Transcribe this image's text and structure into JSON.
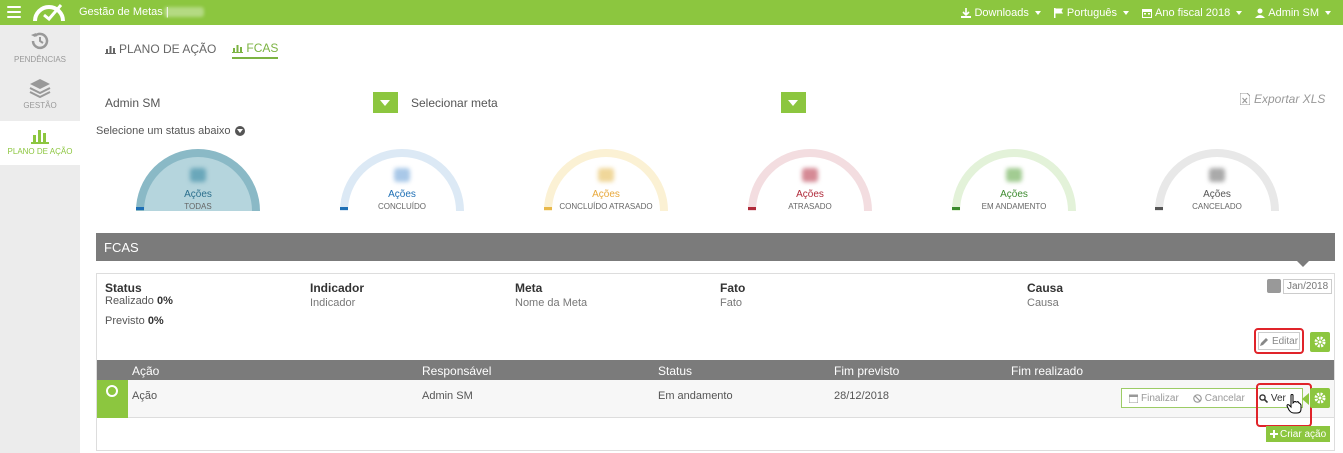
{
  "header": {
    "app_title": "Gestão de Metas |",
    "nav": [
      {
        "label": "Downloads",
        "icon": "download-icon"
      },
      {
        "label": "Português",
        "icon": "flag-icon"
      },
      {
        "label": "Ano fiscal 2018",
        "icon": "calendar-icon"
      },
      {
        "label": "Admin SM",
        "icon": "user-icon"
      }
    ]
  },
  "sidebar": {
    "items": [
      {
        "label": "PENDÊNCIAS",
        "icon": "history-icon"
      },
      {
        "label": "GESTÃO",
        "icon": "layers-icon"
      },
      {
        "label": "PLANO DE AÇÃO",
        "icon": "bar-chart-icon"
      }
    ]
  },
  "tabs": [
    {
      "label": "PLANO DE AÇÃO"
    },
    {
      "label": "FCAS"
    }
  ],
  "filters": {
    "user_value": "Admin SM",
    "goal_value": "Selecionar meta",
    "export_label": "Exportar XLS"
  },
  "status_hint": "Selecione um status abaixo",
  "gauges": [
    {
      "label": "Ações",
      "sub": "TODAS",
      "color": "#8ab9c6"
    },
    {
      "label": "Ações",
      "sub": "CONCLUÍDO",
      "color": "#1e6fb5"
    },
    {
      "label": "Ações",
      "sub": "CONCLUÍDO ATRASADO",
      "color": "#e8b84a"
    },
    {
      "label": "Ações",
      "sub": "ATRASADO",
      "color": "#b02a3a"
    },
    {
      "label": "Ações",
      "sub": "EM ANDAMENTO",
      "color": "#3d8b2f"
    },
    {
      "label": "Ações",
      "sub": "CANCELADO",
      "color": "#555555"
    }
  ],
  "fcas": {
    "section_title": "FCAS",
    "columns": [
      {
        "header": "Status",
        "value": ""
      },
      {
        "header": "Indicador",
        "value": "Indicador"
      },
      {
        "header": "Meta",
        "value": "Nome da Meta"
      },
      {
        "header": "Fato",
        "value": "Fato"
      },
      {
        "header": "Causa",
        "value": "Causa"
      }
    ],
    "realizado_label": "Realizado",
    "realizado_value": "0%",
    "previsto_label": "Previsto",
    "previsto_value": "0%",
    "date": "Jan/2018",
    "edit_label": "Editar"
  },
  "actions": {
    "headers": [
      "Ação",
      "Responsável",
      "Status",
      "Fim previsto",
      "Fim realizado"
    ],
    "row": {
      "acao": "Ação",
      "responsavel": "Admin SM",
      "status": "Em andamento",
      "fim_previsto": "28/12/2018",
      "fim_realizado": ""
    },
    "finalize_label": "Finalizar",
    "cancel_label": "Cancelar",
    "view_label": "Ver",
    "create_label": "Criar ação"
  },
  "colors": {
    "accent": "#8cc63f",
    "header_gray": "#7b7b7b",
    "highlight_red": "#e0242a"
  }
}
